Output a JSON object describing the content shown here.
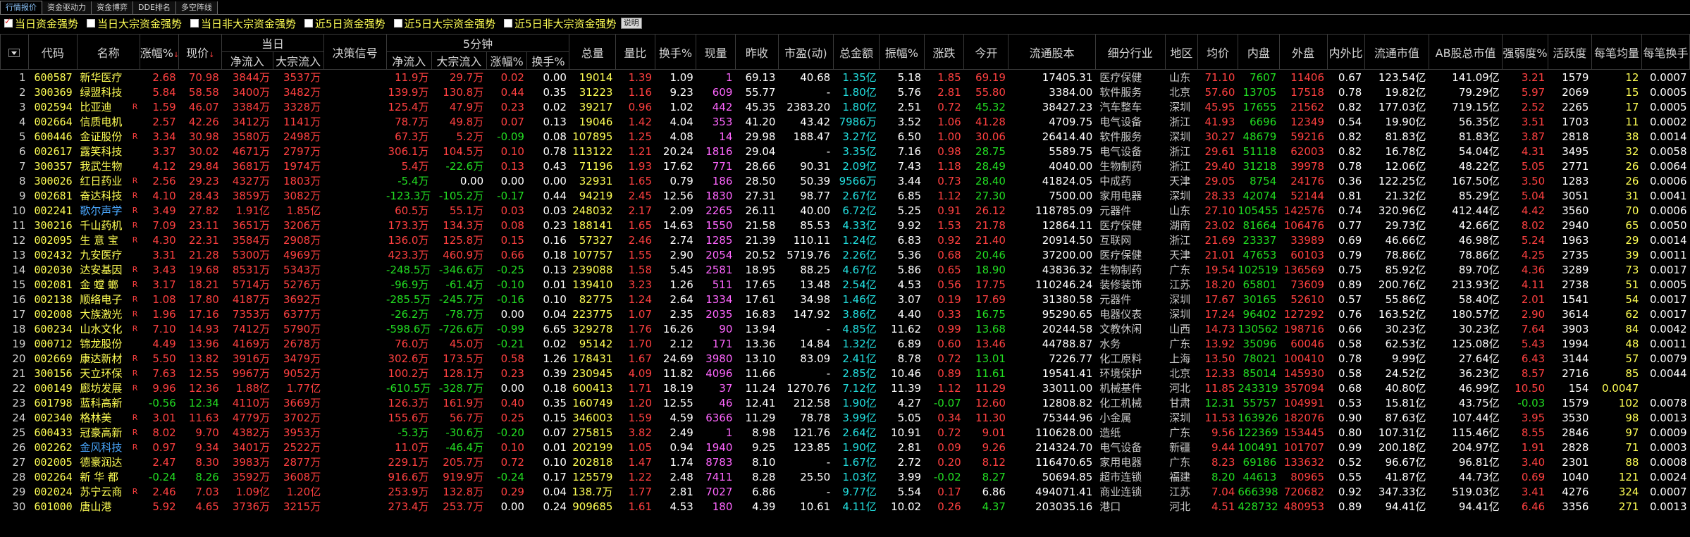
{
  "tabs": [
    "行情报价",
    "资金驱动力",
    "资金博弈",
    "DDE排名",
    "多空阵线"
  ],
  "filters": [
    {
      "label": "当日资金强势",
      "checked": true
    },
    {
      "label": "当日大宗资金强势",
      "checked": false
    },
    {
      "label": "当日非大宗资金强势",
      "checked": false
    },
    {
      "label": "近5日资金强势",
      "checked": false
    },
    {
      "label": "近5日大宗资金强势",
      "checked": false
    },
    {
      "label": "近5日非大宗资金强势",
      "checked": false
    }
  ],
  "filter_button": "说明",
  "groups": {
    "today": "当日",
    "fivemin": "5分钟"
  },
  "headers": {
    "code": "代码",
    "name": "名称",
    "chg_pct": "涨幅%",
    "price": "现价",
    "net_in": "净流入",
    "big_in": "大宗流入",
    "signal": "决策信号",
    "m5_net": "净流入",
    "m5_big": "大宗流入",
    "m5_chg": "涨幅%",
    "m5_turn": "换手%",
    "vol": "总量",
    "vol_ratio": "量比",
    "turnover": "换手%",
    "cur_vol": "现量",
    "prev_close": "昨收",
    "pe": "市盈(动)",
    "amount": "总金额",
    "amplitude": "振幅%",
    "change": "涨跌",
    "open": "今开",
    "float_shares": "流通股本",
    "industry": "细分行业",
    "region": "地区",
    "avg": "均价",
    "inner": "内盘",
    "outer": "外盘",
    "io_ratio": "内外比",
    "float_mv": "流通市值",
    "ab_mv": "AB股总市值",
    "strength": "强弱度%",
    "activity": "活跃度",
    "per_trade": "每笔均量",
    "per_turn": "每笔换手"
  },
  "rows": [
    [
      "1",
      "600587",
      "新华医疗",
      "",
      "2.68",
      "70.98",
      "3844万",
      "3537万",
      "",
      "11.9万",
      "29.7万",
      "0.02",
      "0.00",
      "19014",
      "1.39",
      "1.09",
      "1",
      "69.13",
      "40.68",
      "1.35亿",
      "5.18",
      "1.85",
      "69.19",
      "17405.31",
      "医疗保健",
      "山东",
      "71.10",
      "7607",
      "11406",
      "0.67",
      "123.54亿",
      "141.09亿",
      "3.21",
      "1579",
      "12",
      "0.0007"
    ],
    [
      "2",
      "300369",
      "绿盟科技",
      "",
      "5.84",
      "58.58",
      "3400万",
      "3482万",
      "",
      "139.9万",
      "130.8万",
      "0.44",
      "0.35",
      "31223",
      "1.16",
      "9.23",
      "609",
      "55.77",
      "-",
      "1.80亿",
      "5.76",
      "2.81",
      "55.80",
      "3384.00",
      "软件服务",
      "北京",
      "57.60",
      "13705",
      "17518",
      "0.78",
      "19.82亿",
      "79.29亿",
      "5.97",
      "2069",
      "15",
      "0.0005"
    ],
    [
      "3",
      "002594",
      "比亚迪",
      "R",
      "1.59",
      "46.07",
      "3384万",
      "3328万",
      "",
      "125.4万",
      "47.9万",
      "0.23",
      "0.02",
      "39217",
      "0.96",
      "1.02",
      "442",
      "45.35",
      "2383.20",
      "1.80亿",
      "2.51",
      "0.72",
      "45.32",
      "38427.23",
      "汽车整车",
      "深圳",
      "45.95",
      "17655",
      "21562",
      "0.82",
      "177.03亿",
      "719.15亿",
      "2.52",
      "2265",
      "17",
      "0.0005"
    ],
    [
      "4",
      "002664",
      "信质电机",
      "",
      "2.57",
      "42.26",
      "3412万",
      "1141万",
      "",
      "78.7万",
      "49.8万",
      "0.07",
      "0.13",
      "19046",
      "1.42",
      "4.04",
      "353",
      "41.20",
      "43.42",
      "7986万",
      "3.52",
      "1.06",
      "41.28",
      "4709.75",
      "电气设备",
      "浙江",
      "41.93",
      "6696",
      "12349",
      "0.54",
      "19.90亿",
      "56.35亿",
      "3.51",
      "1703",
      "11",
      "0.0002"
    ],
    [
      "5",
      "600446",
      "金证股份",
      "R",
      "3.34",
      "30.98",
      "3580万",
      "2498万",
      "",
      "67.3万",
      "5.2万",
      "-0.09",
      "0.08",
      "107895",
      "1.25",
      "4.08",
      "14",
      "29.98",
      "188.47",
      "3.27亿",
      "6.50",
      "1.00",
      "30.06",
      "26414.40",
      "软件服务",
      "深圳",
      "30.27",
      "48679",
      "59216",
      "0.82",
      "81.83亿",
      "81.83亿",
      "3.87",
      "2818",
      "38",
      "0.0014"
    ],
    [
      "6",
      "002617",
      "露笑科技",
      "",
      "3.37",
      "30.02",
      "4671万",
      "2797万",
      "",
      "306.1万",
      "104.5万",
      "0.10",
      "0.78",
      "113122",
      "1.21",
      "20.24",
      "1816",
      "29.04",
      "-",
      "3.35亿",
      "7.16",
      "0.98",
      "28.75",
      "5589.75",
      "电气设备",
      "浙江",
      "29.61",
      "51118",
      "62003",
      "0.82",
      "16.78亿",
      "54.04亿",
      "4.31",
      "3495",
      "32",
      "0.0058"
    ],
    [
      "7",
      "300357",
      "我武生物",
      "",
      "4.12",
      "29.84",
      "3681万",
      "1974万",
      "",
      "5.4万",
      "-22.6万",
      "0.13",
      "0.43",
      "71196",
      "1.93",
      "17.62",
      "771",
      "28.66",
      "90.31",
      "2.09亿",
      "7.43",
      "1.18",
      "28.49",
      "4040.00",
      "生物制药",
      "浙江",
      "29.40",
      "31218",
      "39978",
      "0.78",
      "12.06亿",
      "48.22亿",
      "5.05",
      "2771",
      "26",
      "0.0064"
    ],
    [
      "8",
      "300026",
      "红日药业",
      "R",
      "2.56",
      "29.23",
      "4327万",
      "1803万",
      "",
      "-5.4万",
      "0.00",
      "0.00",
      "0.00",
      "32931",
      "1.65",
      "0.79",
      "186",
      "28.50",
      "50.39",
      "9566万",
      "3.44",
      "0.73",
      "28.40",
      "41824.05",
      "中成药",
      "天津",
      "29.05",
      "8754",
      "24176",
      "0.36",
      "122.25亿",
      "167.50亿",
      "3.50",
      "1283",
      "26",
      "0.0006"
    ],
    [
      "9",
      "002681",
      "奋达科技",
      "R",
      "4.10",
      "28.43",
      "3859万",
      "3082万",
      "",
      "-123.3万",
      "-105.2万",
      "-0.17",
      "0.44",
      "94219",
      "2.45",
      "12.56",
      "1830",
      "27.31",
      "98.77",
      "2.67亿",
      "6.85",
      "1.12",
      "27.30",
      "7500.00",
      "家用电器",
      "深圳",
      "28.33",
      "42074",
      "52144",
      "0.81",
      "21.32亿",
      "85.29亿",
      "5.04",
      "3051",
      "31",
      "0.0041"
    ],
    [
      "10",
      "002241",
      "歌尔声学",
      "R",
      "3.49",
      "27.82",
      "1.91亿",
      "1.85亿",
      "",
      "60.5万",
      "55.1万",
      "0.03",
      "0.03",
      "248032",
      "2.17",
      "2.09",
      "2265",
      "26.11",
      "40.00",
      "6.72亿",
      "5.25",
      "0.91",
      "26.12",
      "118785.09",
      "元器件",
      "山东",
      "27.10",
      "105455",
      "142576",
      "0.74",
      "320.96亿",
      "412.44亿",
      "4.42",
      "3560",
      "70",
      "0.0006"
    ],
    [
      "11",
      "300216",
      "千山药机",
      "R",
      "7.09",
      "23.11",
      "3651万",
      "3206万",
      "",
      "173.3万",
      "134.3万",
      "0.08",
      "0.23",
      "188141",
      "1.65",
      "14.63",
      "1550",
      "21.58",
      "85.53",
      "4.33亿",
      "9.92",
      "1.53",
      "21.78",
      "12864.11",
      "医疗保健",
      "湖南",
      "23.02",
      "81664",
      "106476",
      "0.77",
      "29.73亿",
      "42.66亿",
      "8.02",
      "2940",
      "65",
      "0.0050"
    ],
    [
      "12",
      "002095",
      "生 意 宝",
      "R",
      "4.30",
      "22.31",
      "3584万",
      "2908万",
      "",
      "136.0万",
      "125.8万",
      "0.15",
      "0.16",
      "57327",
      "2.46",
      "2.74",
      "1285",
      "21.39",
      "110.11",
      "1.24亿",
      "6.83",
      "0.92",
      "21.40",
      "20914.50",
      "互联网",
      "浙江",
      "21.69",
      "23337",
      "33989",
      "0.69",
      "46.66亿",
      "46.98亿",
      "5.24",
      "1963",
      "29",
      "0.0014"
    ],
    [
      "13",
      "002432",
      "九安医疗",
      "",
      "3.31",
      "21.28",
      "5300万",
      "4969万",
      "",
      "423.3万",
      "460.9万",
      "0.66",
      "0.18",
      "107757",
      "1.55",
      "2.90",
      "2054",
      "20.52",
      "5719.76",
      "2.26亿",
      "5.36",
      "0.68",
      "20.46",
      "37200.00",
      "医疗保健",
      "天津",
      "21.01",
      "47653",
      "60103",
      "0.79",
      "78.86亿",
      "78.86亿",
      "4.25",
      "2735",
      "39",
      "0.0011"
    ],
    [
      "14",
      "002030",
      "达安基因",
      "R",
      "3.43",
      "19.68",
      "8531万",
      "5343万",
      "",
      "-248.5万",
      "-346.6万",
      "-0.25",
      "0.13",
      "239088",
      "1.58",
      "5.45",
      "2581",
      "18.95",
      "88.25",
      "4.67亿",
      "5.86",
      "0.65",
      "18.90",
      "43836.32",
      "生物制药",
      "广东",
      "19.54",
      "102519",
      "136569",
      "0.75",
      "85.92亿",
      "89.70亿",
      "4.36",
      "3289",
      "73",
      "0.0017"
    ],
    [
      "15",
      "002081",
      "金 螳 螂",
      "R",
      "3.17",
      "18.21",
      "5714万",
      "5276万",
      "",
      "-96.9万",
      "-61.4万",
      "-0.10",
      "0.01",
      "139410",
      "3.23",
      "1.26",
      "511",
      "17.65",
      "13.48",
      "2.54亿",
      "4.53",
      "0.56",
      "17.75",
      "110246.24",
      "装修装饰",
      "江苏",
      "18.20",
      "65801",
      "73609",
      "0.89",
      "200.76亿",
      "213.93亿",
      "4.11",
      "2738",
      "51",
      "0.0005"
    ],
    [
      "16",
      "002138",
      "顺络电子",
      "R",
      "1.08",
      "17.80",
      "4187万",
      "3692万",
      "",
      "-285.5万",
      "-245.7万",
      "-0.16",
      "0.10",
      "82775",
      "1.24",
      "2.64",
      "1334",
      "17.61",
      "34.98",
      "1.46亿",
      "3.07",
      "0.19",
      "17.69",
      "31380.58",
      "元器件",
      "深圳",
      "17.67",
      "30165",
      "52610",
      "0.57",
      "55.86亿",
      "58.40亿",
      "2.01",
      "1541",
      "54",
      "0.0017"
    ],
    [
      "17",
      "002008",
      "大族激光",
      "R",
      "1.96",
      "17.16",
      "7353万",
      "6377万",
      "",
      "-26.2万",
      "-78.7万",
      "0.00",
      "0.04",
      "223775",
      "1.07",
      "2.35",
      "2035",
      "16.83",
      "147.92",
      "3.86亿",
      "4.40",
      "0.33",
      "16.75",
      "95290.65",
      "电器仪表",
      "深圳",
      "17.24",
      "96402",
      "127292",
      "0.76",
      "163.52亿",
      "180.57亿",
      "2.90",
      "3614",
      "62",
      "0.0017"
    ],
    [
      "18",
      "600234",
      "山水文化",
      "R",
      "7.10",
      "14.93",
      "7412万",
      "5790万",
      "",
      "-598.6万",
      "-726.6万",
      "-0.99",
      "6.65",
      "329278",
      "1.76",
      "16.26",
      "90",
      "13.94",
      "-",
      "4.85亿",
      "11.62",
      "0.99",
      "13.68",
      "20244.58",
      "文教休闲",
      "山西",
      "14.73",
      "130562",
      "198716",
      "0.66",
      "30.23亿",
      "30.23亿",
      "7.64",
      "3903",
      "84",
      "0.0042"
    ],
    [
      "19",
      "000712",
      "锦龙股份",
      "",
      "4.49",
      "13.96",
      "4169万",
      "2678万",
      "",
      "76.0万",
      "45.0万",
      "-0.21",
      "0.02",
      "95142",
      "1.70",
      "2.12",
      "171",
      "13.36",
      "14.84",
      "1.32亿",
      "6.89",
      "0.60",
      "13.46",
      "44788.87",
      "水务",
      "广东",
      "13.92",
      "35096",
      "60046",
      "0.58",
      "62.53亿",
      "125.08亿",
      "5.43",
      "1994",
      "48",
      "0.0011"
    ],
    [
      "20",
      "002669",
      "康达新材",
      "R",
      "5.50",
      "13.82",
      "3916万",
      "3479万",
      "",
      "302.6万",
      "173.5万",
      "0.58",
      "1.26",
      "178431",
      "1.67",
      "24.69",
      "3980",
      "13.10",
      "83.09",
      "2.41亿",
      "8.78",
      "0.72",
      "13.01",
      "7226.77",
      "化工原料",
      "上海",
      "13.50",
      "78021",
      "100410",
      "0.78",
      "9.99亿",
      "27.64亿",
      "6.43",
      "3144",
      "57",
      "0.0079"
    ],
    [
      "21",
      "300156",
      "天立环保",
      "R",
      "7.63",
      "12.55",
      "9967万",
      "9052万",
      "",
      "100.2万",
      "128.1万",
      "0.23",
      "0.39",
      "230945",
      "4.09",
      "11.82",
      "4096",
      "11.66",
      "-",
      "2.85亿",
      "10.46",
      "0.89",
      "11.61",
      "19541.41",
      "环境保护",
      "北京",
      "12.33",
      "85014",
      "145930",
      "0.58",
      "24.52亿",
      "36.23亿",
      "8.57",
      "2716",
      "85",
      "0.0044"
    ],
    [
      "22",
      "000149",
      "廊坊发展",
      "R",
      "9.96",
      "12.36",
      "1.88亿",
      "1.77亿",
      "",
      "-610.5万",
      "-328.7万",
      "0.00",
      "0.18",
      "600413",
      "1.71",
      "18.19",
      "37",
      "11.24",
      "1270.76",
      "7.12亿",
      "11.39",
      "1.12",
      "11.29",
      "33011.00",
      "机械基件",
      "河北",
      "11.85",
      "243319",
      "357094",
      "0.68",
      "40.80亿",
      "46.99亿",
      "10.50",
      "154",
      "0.0047"
    ],
    [
      "23",
      "601798",
      "蓝科高新",
      "",
      "-0.56",
      "12.34",
      "4110万",
      "3669万",
      "",
      "126.3万",
      "161.9万",
      "0.40",
      "0.35",
      "160749",
      "1.20",
      "12.55",
      "46",
      "12.41",
      "212.58",
      "1.90亿",
      "4.27",
      "-0.07",
      "12.60",
      "12808.82",
      "化工机械",
      "甘肃",
      "12.31",
      "55757",
      "104991",
      "0.53",
      "15.81亿",
      "43.75亿",
      "-0.03",
      "1579",
      "102",
      "0.0078"
    ],
    [
      "24",
      "002340",
      "格林美",
      "R",
      "3.01",
      "11.63",
      "4779万",
      "3702万",
      "",
      "155.6万",
      "56.7万",
      "0.25",
      "0.15",
      "346003",
      "1.59",
      "4.59",
      "6366",
      "11.29",
      "78.78",
      "3.99亿",
      "5.05",
      "0.34",
      "11.30",
      "75344.96",
      "小金属",
      "深圳",
      "11.53",
      "163926",
      "182076",
      "0.90",
      "87.63亿",
      "107.44亿",
      "3.95",
      "3530",
      "98",
      "0.0013"
    ],
    [
      "25",
      "600433",
      "冠豪高新",
      "R",
      "8.02",
      "9.70",
      "4382万",
      "3953万",
      "",
      "-5.3万",
      "-30.6万",
      "-0.20",
      "0.07",
      "275815",
      "3.82",
      "2.49",
      "1",
      "8.98",
      "121.76",
      "2.64亿",
      "10.91",
      "0.72",
      "9.01",
      "110628.00",
      "造纸",
      "广东",
      "9.56",
      "122369",
      "153445",
      "0.80",
      "107.31亿",
      "115.46亿",
      "8.55",
      "2846",
      "97",
      "0.0009"
    ],
    [
      "26",
      "002262",
      "金风科技",
      "R",
      "0.97",
      "9.34",
      "3401万",
      "2522万",
      "",
      "11.0万",
      "-46.4万",
      "0.10",
      "0.01",
      "202199",
      "1.05",
      "0.94",
      "1940",
      "9.25",
      "123.85",
      "1.90亿",
      "2.81",
      "0.09",
      "9.26",
      "214324.70",
      "电气设备",
      "新疆",
      "9.44",
      "100491",
      "101707",
      "0.99",
      "200.18亿",
      "204.97亿",
      "1.91",
      "2828",
      "71",
      "0.0003"
    ],
    [
      "27",
      "002005",
      "德豪润达",
      "",
      "2.47",
      "8.30",
      "3983万",
      "2877万",
      "",
      "229.1万",
      "205.7万",
      "0.72",
      "0.10",
      "202818",
      "1.47",
      "1.74",
      "8783",
      "8.10",
      "-",
      "1.67亿",
      "2.72",
      "0.20",
      "8.12",
      "116470.65",
      "家用电器",
      "广东",
      "8.23",
      "69186",
      "133632",
      "0.52",
      "96.67亿",
      "96.81亿",
      "3.40",
      "2301",
      "88",
      "0.0008"
    ],
    [
      "28",
      "002264",
      "新 华 都",
      "",
      "-0.24",
      "8.26",
      "3592万",
      "3608万",
      "",
      "916.6万",
      "919.9万",
      "-0.24",
      "0.17",
      "125579",
      "1.22",
      "2.48",
      "7411",
      "8.28",
      "25.50",
      "1.03亿",
      "3.99",
      "-0.02",
      "8.27",
      "50694.85",
      "超市连锁",
      "福建",
      "8.20",
      "44613",
      "80965",
      "0.55",
      "41.87亿",
      "44.73亿",
      "0.69",
      "1040",
      "121",
      "0.0024"
    ],
    [
      "29",
      "002024",
      "苏宁云商",
      "R",
      "2.46",
      "7.03",
      "1.09亿",
      "1.20亿",
      "",
      "253.9万",
      "132.8万",
      "0.29",
      "0.04",
      "138.7万",
      "1.77",
      "2.81",
      "7027",
      "6.86",
      "-",
      "9.77亿",
      "5.54",
      "0.17",
      "6.86",
      "494071.41",
      "商业连锁",
      "江苏",
      "7.04",
      "666398",
      "720682",
      "0.92",
      "347.33亿",
      "519.03亿",
      "3.41",
      "4276",
      "324",
      "0.0007"
    ],
    [
      "30",
      "601000",
      "唐山港",
      "",
      "5.92",
      "4.65",
      "3736万",
      "3215万",
      "",
      "273.4万",
      "253.7万",
      "0.00",
      "0.24",
      "909685",
      "1.61",
      "4.53",
      "180",
      "4.39",
      "10.61",
      "4.11亿",
      "10.02",
      "0.26",
      "4.37",
      "203035.16",
      "港口",
      "河北",
      "4.51",
      "428732",
      "480953",
      "0.89",
      "94.41亿",
      "94.41亿",
      "6.46",
      "3356",
      "271",
      "0.0013"
    ]
  ]
}
